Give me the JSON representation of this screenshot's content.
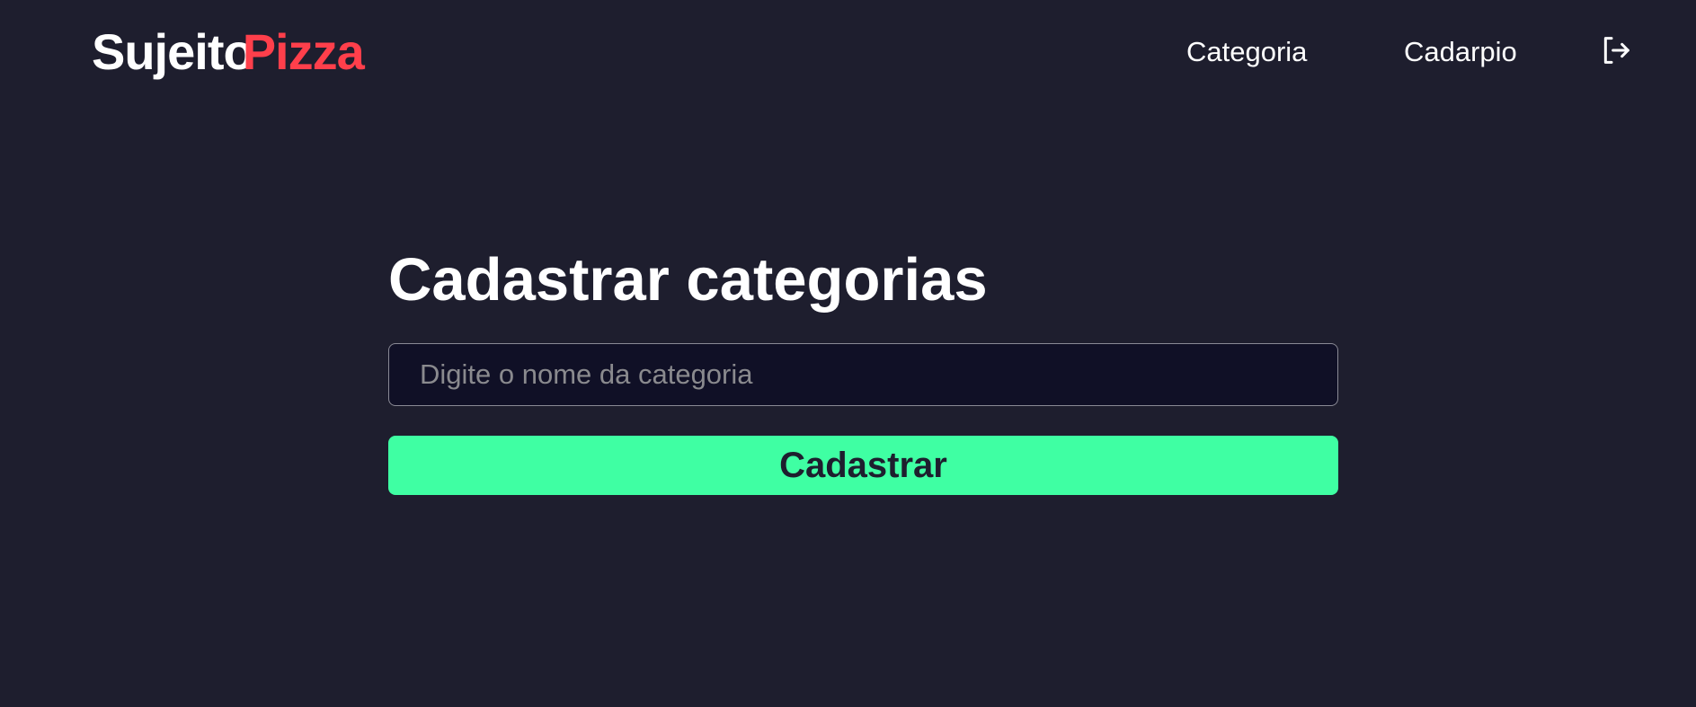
{
  "header": {
    "logo": {
      "part_a": "Sujeito",
      "part_b": "Pizza"
    },
    "nav": {
      "categoria": "Categoria",
      "cardapio": "Cadarpio"
    },
    "logout_icon": "logout-icon"
  },
  "main": {
    "title": "Cadastrar categorias",
    "input": {
      "placeholder": "Digite o nome da categoria",
      "value": ""
    },
    "submit_label": "Cadastrar"
  },
  "colors": {
    "background": "#1e1e2e",
    "brand_red": "#ff3f4b",
    "input_background": "#101026",
    "accent_green": "#3fffa3",
    "text": "#ffffff"
  }
}
